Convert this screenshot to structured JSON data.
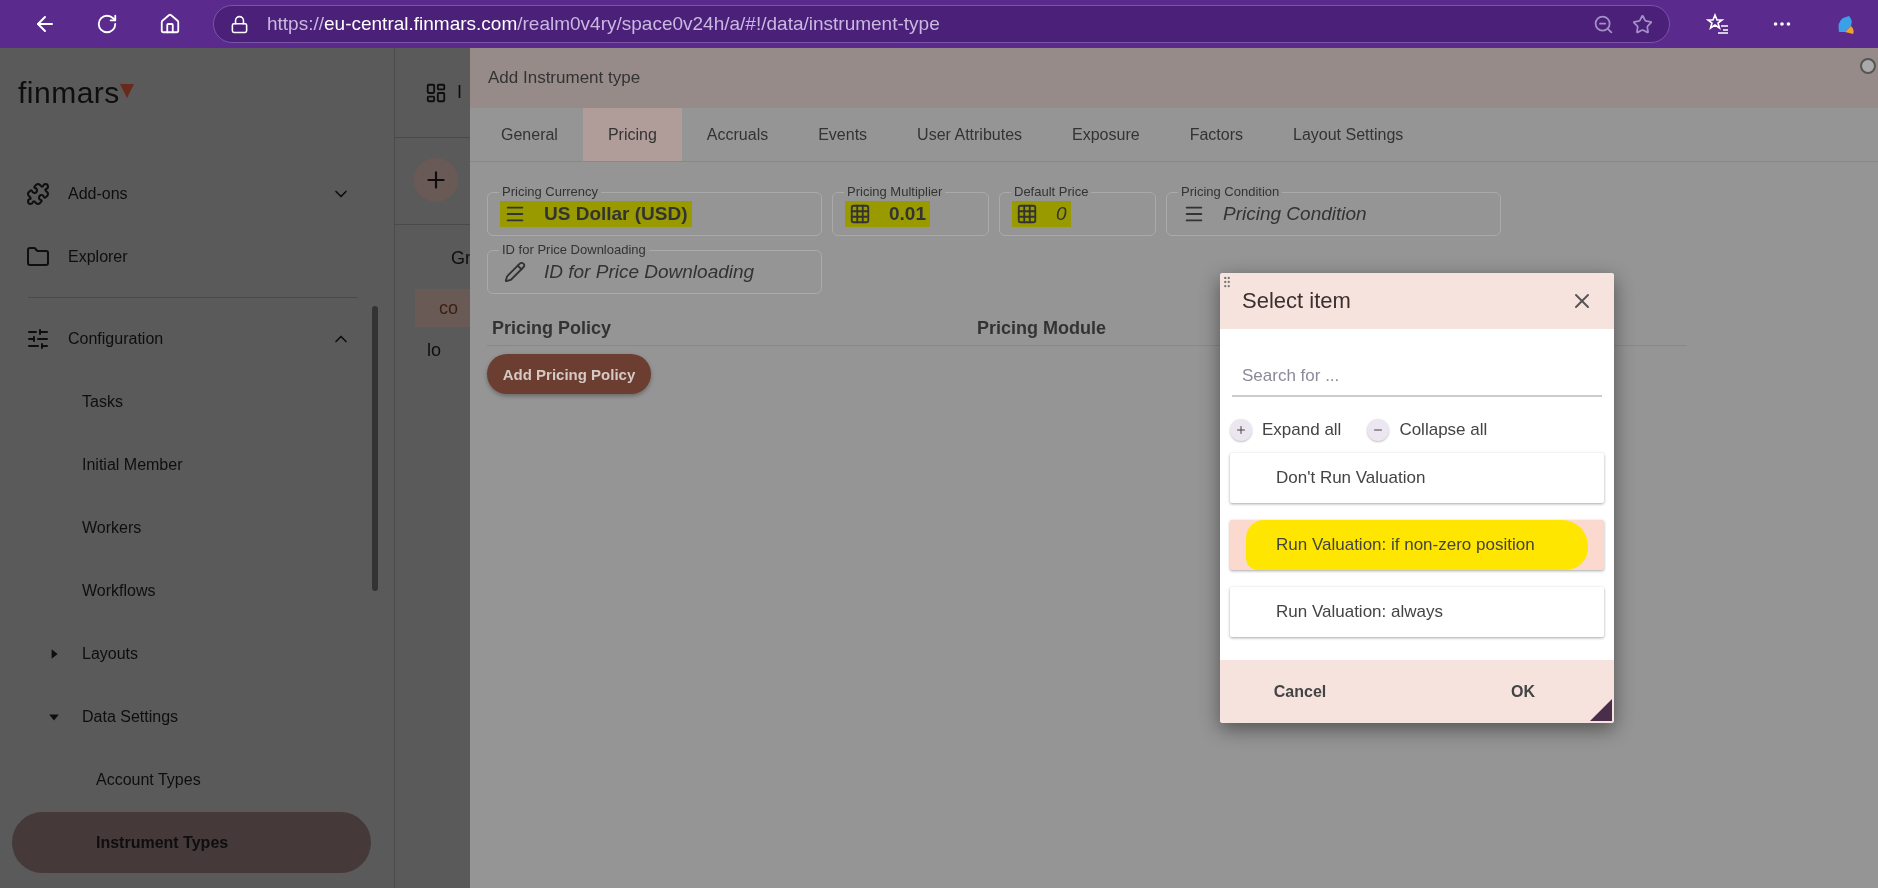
{
  "browser": {
    "url": {
      "scheme": "https://",
      "domain": "eu-central.finmars.com",
      "path": "/realm0v4ry/space0v24h/a/#!/data/instrument-type"
    }
  },
  "sidebar": {
    "logo": "finmars",
    "items": [
      {
        "label": "Add-ons",
        "expanded": false,
        "selected": false
      },
      {
        "label": "Explorer",
        "selected": false
      },
      {
        "label": "Configuration",
        "expanded": true,
        "selected": false,
        "children": [
          {
            "label": "Tasks",
            "selected": false
          },
          {
            "label": "Initial Member",
            "selected": false
          },
          {
            "label": "Workers",
            "selected": false
          },
          {
            "label": "Workflows",
            "selected": false
          },
          {
            "label": "Layouts",
            "expanded": false,
            "selected": false
          },
          {
            "label": "Data Settings",
            "expanded": true,
            "selected": false,
            "children": [
              {
                "label": "Account Types",
                "selected": false
              },
              {
                "label": "Instrument Types",
                "selected": true
              }
            ]
          }
        ]
      }
    ]
  },
  "background_list": {
    "heading": "I",
    "group": "Gr",
    "rows": [
      {
        "label": "co",
        "selected": true
      },
      {
        "label": "lo",
        "selected": false
      }
    ]
  },
  "panel": {
    "title": "Add Instrument type",
    "tabs": [
      {
        "label": "General",
        "selected": false
      },
      {
        "label": "Pricing",
        "selected": true
      },
      {
        "label": "Accruals",
        "selected": false
      },
      {
        "label": "Events",
        "selected": false
      },
      {
        "label": "User Attributes",
        "selected": false
      },
      {
        "label": "Exposure",
        "selected": false
      },
      {
        "label": "Factors",
        "selected": false
      },
      {
        "label": "Layout Settings",
        "selected": false
      }
    ],
    "fields": [
      {
        "label": "Pricing Currency",
        "kind": "select",
        "value": "US Dollar (USD)",
        "highlighted": true
      },
      {
        "label": "Pricing Multiplier",
        "kind": "number",
        "value": "0.01",
        "highlighted": true
      },
      {
        "label": "Default Price",
        "kind": "number",
        "placeholder": "0",
        "highlighted": true
      },
      {
        "label": "Pricing Condition",
        "kind": "select",
        "placeholder": "Pricing Condition",
        "highlighted": false
      },
      {
        "label": "ID for Price Downloading",
        "kind": "text",
        "placeholder": "ID for Price Downloading",
        "highlighted": false
      }
    ],
    "table": {
      "columns": [
        "Pricing Policy",
        "Pricing Module"
      ]
    },
    "add_button": "Add Pricing Policy"
  },
  "dialog": {
    "title": "Select item",
    "search": {
      "placeholder": "Search for ..."
    },
    "expand_all": "Expand all",
    "collapse_all": "Collapse all",
    "items": [
      {
        "label": "Don't Run Valuation",
        "selected": false,
        "highlighted": false
      },
      {
        "label": "Run Valuation: if non-zero position",
        "selected": true,
        "highlighted": true
      },
      {
        "label": "Run Valuation: always",
        "selected": false,
        "highlighted": false
      }
    ],
    "buttons": [
      "Cancel",
      "OK"
    ]
  }
}
